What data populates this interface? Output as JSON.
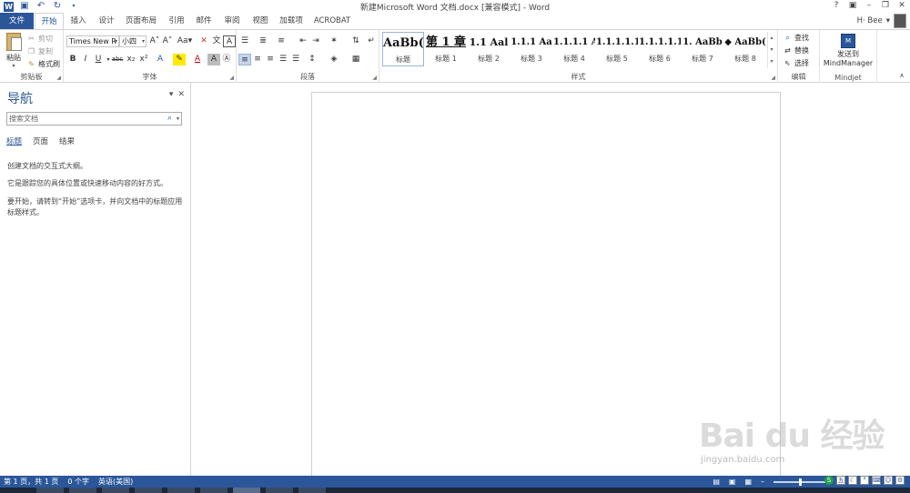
{
  "titlebar": {
    "title": "新建Microsoft Word 文档.docx [兼容模式] - Word",
    "help": "?",
    "user": "H· Bee",
    "user_dropdown": "▾"
  },
  "qat": {
    "save_icon": "save-icon",
    "undo_icon": "undo-icon",
    "redo_icon": "redo-icon"
  },
  "tabs": [
    "文件",
    "开始",
    "插入",
    "设计",
    "页面布局",
    "引用",
    "邮件",
    "审阅",
    "视图",
    "加载项",
    "ACROBAT"
  ],
  "clipboard": {
    "paste": "粘贴",
    "cut": "剪切",
    "copy": "复制",
    "format_painter": "格式刷",
    "group_label": "剪贴板"
  },
  "font": {
    "family": "Times New R",
    "size": "小四",
    "group_label": "字体"
  },
  "paragraph": {
    "group_label": "段落"
  },
  "styles": {
    "items": [
      {
        "sample": "AaBb(",
        "name": "标题"
      },
      {
        "sample": "第 1 章",
        "name": "标题 1"
      },
      {
        "sample": "1.1  Aal",
        "name": "标题 2"
      },
      {
        "sample": "1.1.1  Aa",
        "name": "标题 3"
      },
      {
        "sample": "1.1.1.1  A",
        "name": "标题 4"
      },
      {
        "sample": "1.1.1.1.1",
        "name": "标题 5"
      },
      {
        "sample": "1.1.1.1.1.",
        "name": "标题 6"
      },
      {
        "sample": "1.  AaBb",
        "name": "标题 7"
      },
      {
        "sample": "◆  AaBb(",
        "name": "标题 8"
      }
    ],
    "group_label": "样式"
  },
  "editing": {
    "find": "查找",
    "replace": "替换",
    "select": "选择",
    "group_label": "编辑"
  },
  "mindjet": {
    "send_to": "发送到",
    "product": "MindManager",
    "group_label": "Mindjet"
  },
  "nav": {
    "title": "导航",
    "search_placeholder": "搜索文档",
    "tabs": [
      "标题",
      "页面",
      "结果"
    ],
    "para1": "创建文档的交互式大纲。",
    "para2": "它是跟踪您的具体位置或快速移动内容的好方式。",
    "para3": "要开始，请转到“开始”选项卡，并向文档中的标题应用标题样式。"
  },
  "status": {
    "page": "第 1 页，共 1 页",
    "words": "0 个字",
    "language": "英语(美国)"
  },
  "watermark": {
    "brand": "Bai du 经验",
    "url": "jingyan.baidu.com"
  },
  "colors": {
    "accent": "#2b579a"
  }
}
